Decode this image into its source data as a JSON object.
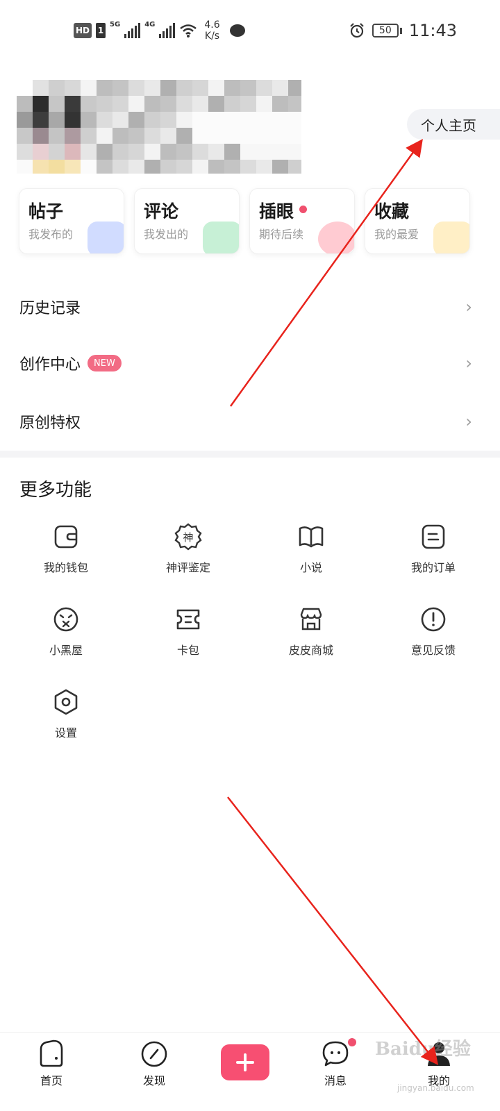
{
  "status_bar": {
    "hd": "HD",
    "sim": "1",
    "net1": "5G",
    "net2": "4G",
    "speed_value": "4.6",
    "speed_unit": "K/s",
    "battery": "50",
    "time": "11:43"
  },
  "profile": {
    "link_label": "个人主页"
  },
  "cards": [
    {
      "title": "帖子",
      "sub": "我发布的",
      "deco_color": "#7b9cff"
    },
    {
      "title": "评论",
      "sub": "我发出的",
      "deco_color": "#5fd48a"
    },
    {
      "title": "插眼",
      "sub": "期待后续",
      "deco_color": "#ff6b7d"
    },
    {
      "title": "收藏",
      "sub": "我的最爱",
      "deco_color": "#ffd15c"
    }
  ],
  "menu": {
    "history": "历史记录",
    "creator": "创作中心",
    "creator_badge": "NEW",
    "original": "原创特权",
    "chevron": "›"
  },
  "more": {
    "title": "更多功能",
    "items": [
      {
        "label": "我的钱包",
        "icon": "wallet-icon"
      },
      {
        "label": "神评鉴定",
        "icon": "badge-icon"
      },
      {
        "label": "小说",
        "icon": "book-icon"
      },
      {
        "label": "我的订单",
        "icon": "order-icon"
      },
      {
        "label": "小黑屋",
        "icon": "face-icon"
      },
      {
        "label": "卡包",
        "icon": "ticket-icon"
      },
      {
        "label": "皮皮商城",
        "icon": "shop-icon"
      },
      {
        "label": "意见反馈",
        "icon": "alert-icon"
      },
      {
        "label": "设置",
        "icon": "settings-icon"
      }
    ],
    "badge_char": "神"
  },
  "nav": {
    "home": "首页",
    "discover": "发现",
    "messages": "消息",
    "mine": "我的"
  },
  "watermark": {
    "main": "Baidu经验",
    "sub": "jingyan.baidu.com"
  },
  "colors": {
    "accent": "#f74f72",
    "arrow": "#e8231c"
  }
}
